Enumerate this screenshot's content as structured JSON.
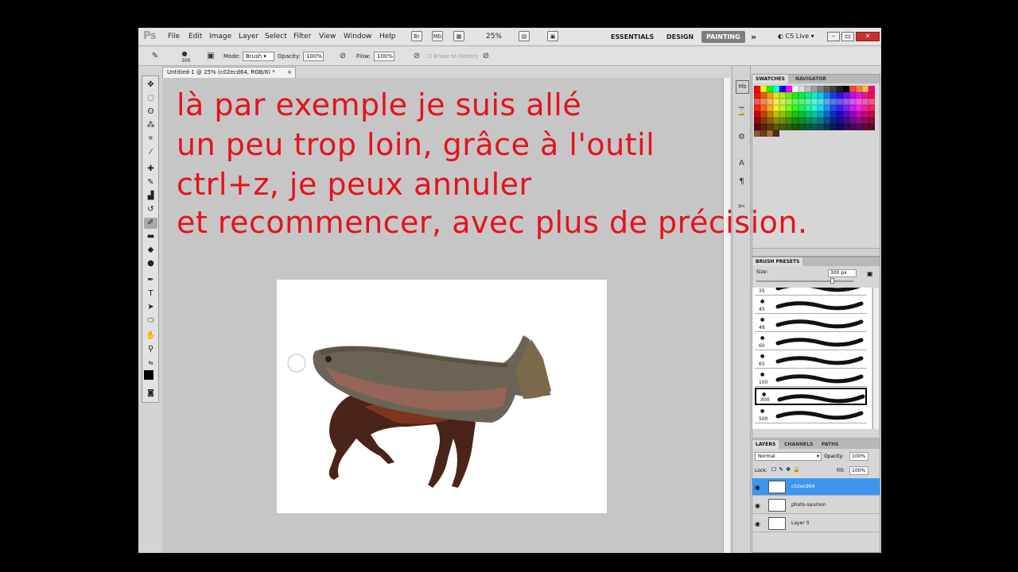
{
  "app": {
    "logo": "Ps"
  },
  "menu": [
    "File",
    "Edit",
    "Image",
    "Layer",
    "Select",
    "Filter",
    "View",
    "Window",
    "Help"
  ],
  "toolbar_icons": [
    "bridge-icon",
    "mini-bridge-icon",
    "grid-icon",
    "arrange-icon",
    "screen-mode-icon"
  ],
  "zoom": "25%",
  "workspaces": {
    "essentials": "ESSENTIALS",
    "design": "DESIGN",
    "painting": "PAINTING",
    "more": "»"
  },
  "cslive": "CS Live",
  "window_buttons": {
    "min": "–",
    "max": "▭",
    "close": "✕"
  },
  "options": {
    "brush_size": "300",
    "mode_label": "Mode:",
    "mode_value": "Brush",
    "opacity_label": "Opacity:",
    "opacity_value": "100%",
    "flow_label": "Flow:",
    "flow_value": "100%",
    "erase_history": "Erase to History"
  },
  "document": {
    "tab_title": "Untitled-1 @ 25% (c02ecd64, RGB/8) *",
    "close": "×"
  },
  "overlay_lines": [
    "là par exemple je suis allé",
    "un peu trop loin, grâce à l'outil",
    "ctrl+z, je peux annuler",
    "et recommencer, avec plus de précision."
  ],
  "swatches_panel": {
    "tabs": [
      "SWATCHES",
      "NAVIGATOR"
    ]
  },
  "brush_presets": {
    "tab": "BRUSH PRESETS",
    "size_label": "Size:",
    "size_value": "300 px",
    "sizes": [
      "35",
      "45",
      "48",
      "60",
      "65",
      "100",
      "300",
      "500"
    ],
    "selected_index": 6
  },
  "layers_panel": {
    "tabs": [
      "LAYERS",
      "CHANNELS",
      "PATHS"
    ],
    "blend_mode": "Normal",
    "opacity_label": "Opacity:",
    "opacity_value": "100%",
    "lock_label": "Lock:",
    "fill_label": "Fill:",
    "fill_value": "100%",
    "layers": [
      {
        "name": "c02ecd64",
        "selected": true
      },
      {
        "name": "photo-saumon",
        "selected": false
      },
      {
        "name": "Layer 0",
        "selected": false
      }
    ]
  },
  "colors": {
    "overlay_text": "#e5121d",
    "layer_selected": "#3e95f0",
    "workspace_active": "#7e7e7e"
  }
}
